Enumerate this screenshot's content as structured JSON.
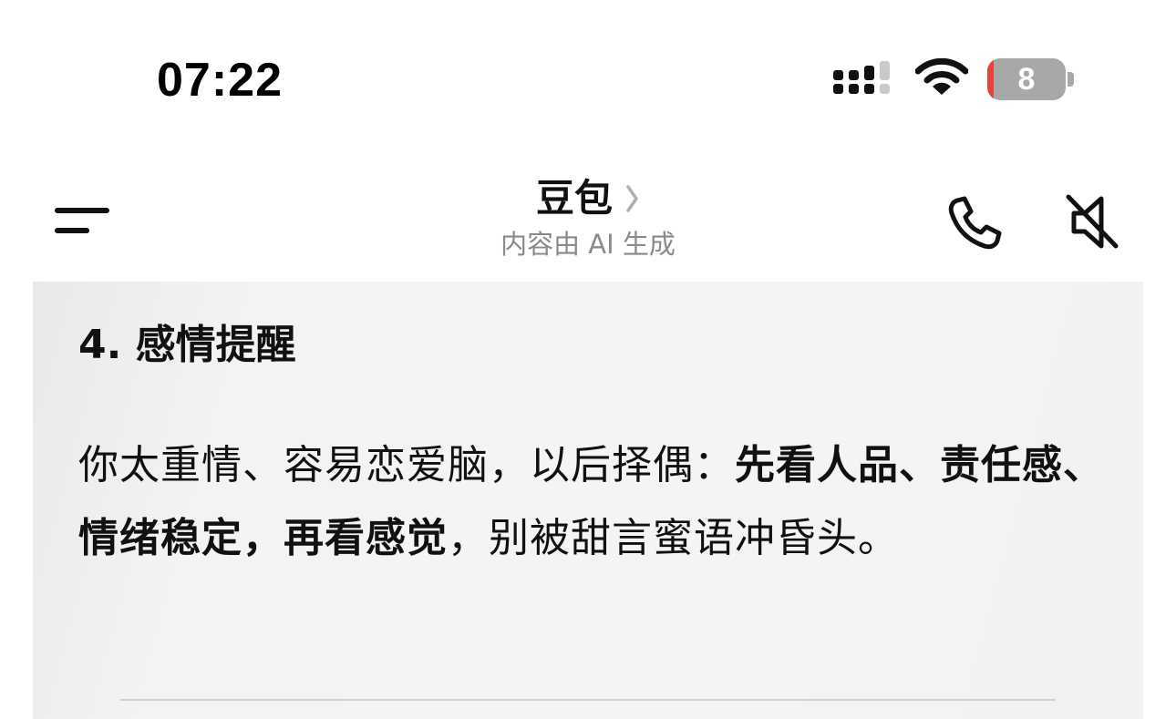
{
  "status_bar": {
    "time": "07:22",
    "battery_level": "8",
    "battery_fill_fraction": 0.08,
    "icons": [
      "signal-icon",
      "wifi-icon",
      "battery-icon"
    ]
  },
  "nav": {
    "title": "豆包",
    "subtitle": "内容由 AI 生成",
    "icons": [
      "menu-icon",
      "chevron-right-icon",
      "phone-icon",
      "speaker-muted-icon"
    ]
  },
  "message": {
    "heading": "4. 感情提醒",
    "paragraph_plain_1": "你太重情、容易恋爱脑，以后择偶：",
    "paragraph_bold": "先看人品、责任感、情绪稳定，再看感觉",
    "paragraph_plain_2": "，别被甜言蜜语冲昏头。"
  },
  "colors": {
    "card_background": "#f4f4f5",
    "subtitle_gray": "#8a8a8a",
    "battery_gray": "#a8a8a8",
    "battery_red": "#e8433a"
  }
}
